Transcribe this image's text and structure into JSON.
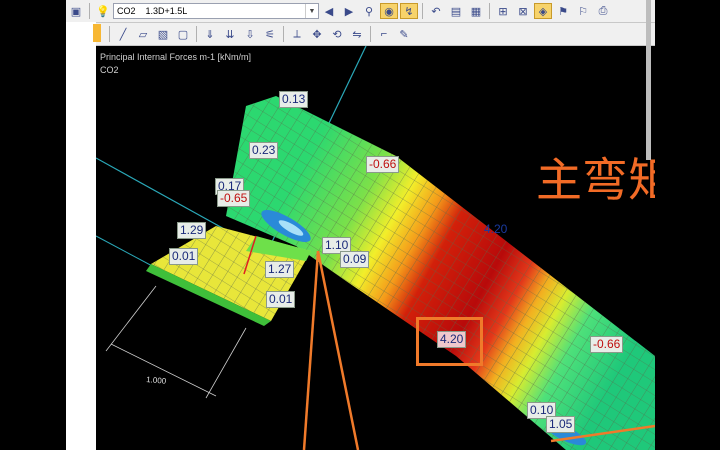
{
  "toolbar1": {
    "load_case_id": "CO2",
    "load_case_combo": "1.3D+1.5L"
  },
  "viewport": {
    "result_title": "Principal Internal Forces m-1 [kNm/m]",
    "load_case": "CO2",
    "overlay_text": "主弯矩",
    "dimension": "1.000",
    "values": {
      "v013": "0.13",
      "v023": "0.23",
      "v_neg066_top": "-0.66",
      "v017": "0.17",
      "v_neg065": "-0.65",
      "v420_top": "4.20",
      "v129": "1.29",
      "v110": "1.10",
      "v009": "0.09",
      "v001_a": "0.01",
      "v127": "1.27",
      "v001_b": "0.01",
      "v420_box": "4.20",
      "v_neg066_right": "-0.66",
      "v010": "0.10",
      "v105": "1.05"
    }
  },
  "colors": {
    "annotation_orange": "#f07a2a",
    "max_band": "#b00a0a",
    "base_band": "#1fc86a"
  }
}
